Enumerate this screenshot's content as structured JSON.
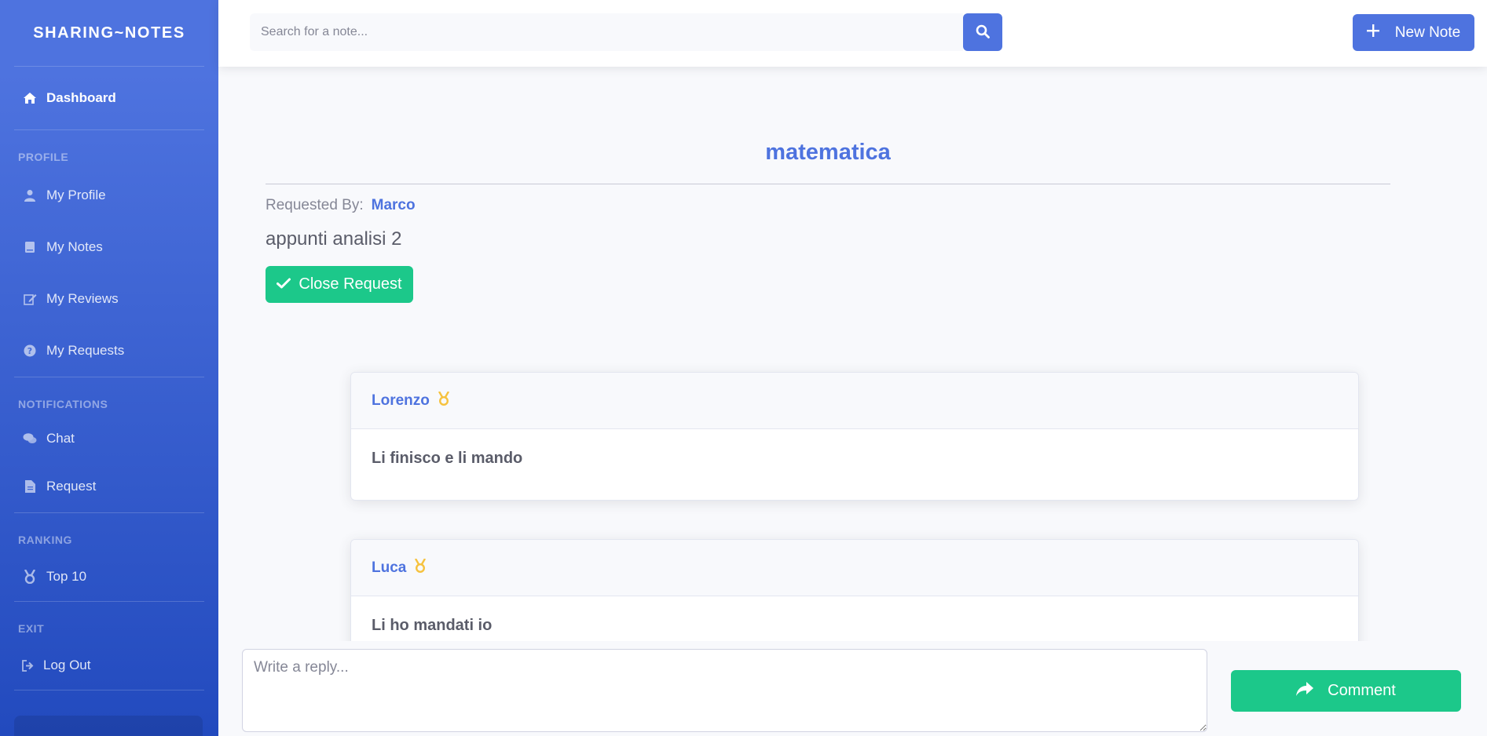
{
  "sidebar": {
    "brand": "SHARING~NOTES",
    "dashboard": {
      "label": "Dashboard",
      "icon": "home-icon"
    },
    "sections": [
      {
        "heading": "PROFILE",
        "items": [
          {
            "label": "My Profile",
            "icon": "user-icon"
          },
          {
            "label": "My Notes",
            "icon": "book-icon"
          },
          {
            "label": "My Reviews",
            "icon": "edit-icon"
          },
          {
            "label": "My Requests",
            "icon": "question-circle-icon"
          }
        ]
      },
      {
        "heading": "NOTIFICATIONS",
        "items": [
          {
            "label": "Chat",
            "icon": "comments-icon"
          },
          {
            "label": "Request",
            "icon": "file-icon"
          }
        ]
      },
      {
        "heading": "RANKING",
        "items": [
          {
            "label": "Top 10",
            "icon": "medal-icon"
          }
        ]
      },
      {
        "heading": "EXIT",
        "items": [
          {
            "label": "Log Out",
            "icon": "sign-out-icon"
          }
        ]
      }
    ]
  },
  "topbar": {
    "search_placeholder": "Search for a note...",
    "new_note_label": "New Note"
  },
  "request": {
    "title": "matematica",
    "requested_by_label": "Requested By:",
    "requested_by_user": "Marco",
    "description": "appunti analisi 2",
    "close_label": "Close Request"
  },
  "comments": [
    {
      "author": "Lorenzo",
      "text": "Li finisco e li mando"
    },
    {
      "author": "Luca",
      "text": "Li ho mandati io"
    }
  ],
  "reply": {
    "placeholder": "Write a reply...",
    "button_label": "Comment"
  },
  "colors": {
    "primary": "#4e73df",
    "success": "#1cc88a",
    "medal": "#f6c23e"
  }
}
